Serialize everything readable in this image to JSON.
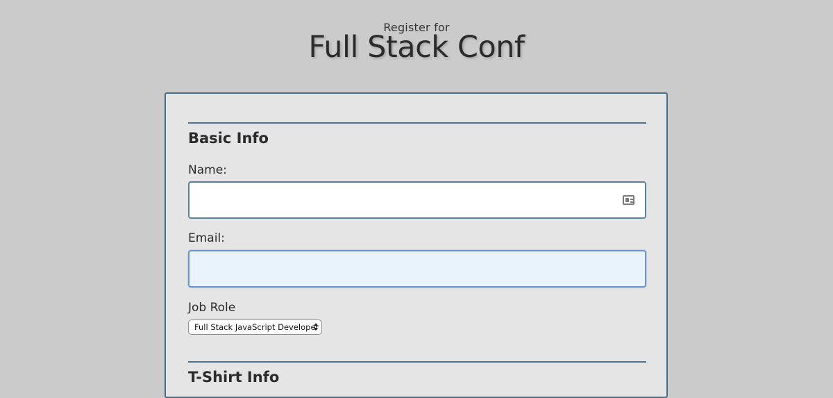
{
  "header": {
    "pretitle": "Register for",
    "title": "Full Stack Conf"
  },
  "basic_info": {
    "heading": "Basic Info",
    "name": {
      "label": "Name:",
      "value": "",
      "placeholder": ""
    },
    "email": {
      "label": "Email:",
      "value": "",
      "placeholder": ""
    },
    "job_role": {
      "label": "Job Role",
      "selected": "Full Stack JavaScript Developer"
    }
  },
  "tshirt_info": {
    "heading": "T-Shirt Info"
  },
  "icons": {
    "name_field_icon": "contact-card-icon",
    "select_arrows": "updown-arrows-icon"
  },
  "colors": {
    "page_background": "#cbcbcb",
    "card_background": "#e5e5e5",
    "card_border": "#4a6f8c",
    "focused_input_background": "#e8f3fc",
    "focused_input_border": "#6e94cf"
  }
}
